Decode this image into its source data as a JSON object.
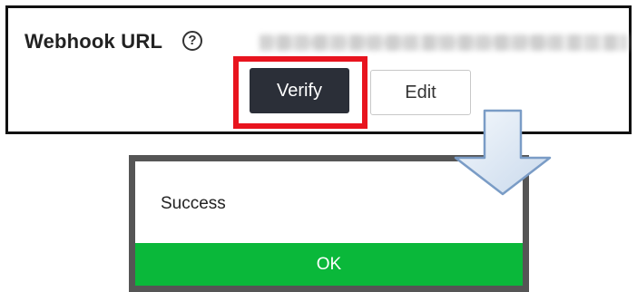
{
  "webhook": {
    "label": "Webhook URL",
    "help_glyph": "?",
    "url_value": "https://api.example-bot.io/webhook/callback"
  },
  "actions": {
    "verify_label": "Verify",
    "edit_label": "Edit"
  },
  "dialog": {
    "message": "Success",
    "ok_label": "OK"
  },
  "colors": {
    "highlight": "#e8141e",
    "verify_bg": "#2b2f38",
    "ok_bg": "#0ab83a",
    "arrow_fill": "#dfe9f5",
    "arrow_stroke": "#7a9cc6"
  },
  "icons": {
    "help": "help-circle-icon",
    "arrow": "down-arrow-icon"
  }
}
